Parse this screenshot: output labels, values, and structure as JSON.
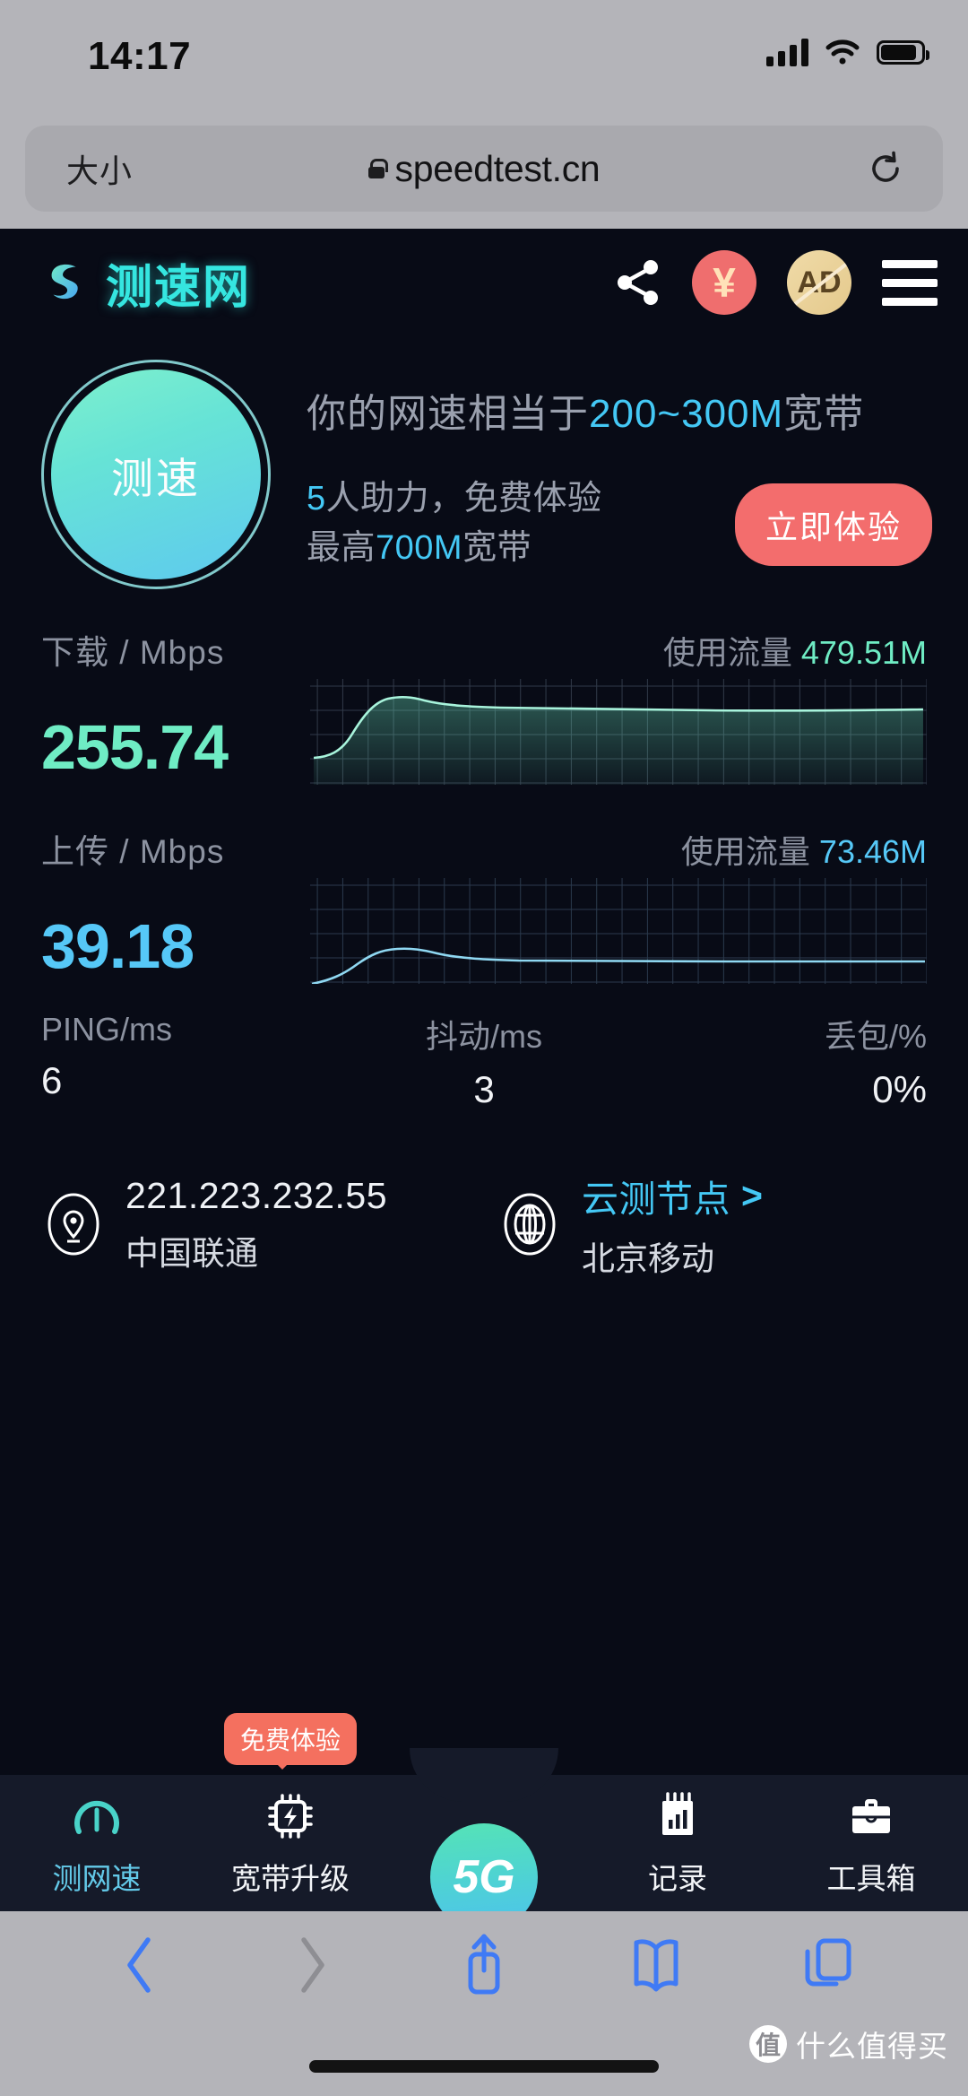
{
  "status_bar": {
    "time": "14:17",
    "signal_icon": "cellular-signal-icon",
    "wifi_icon": "wifi-icon",
    "battery_icon": "battery-icon"
  },
  "browser": {
    "text_size_label": "大小",
    "lock_icon": "lock-icon",
    "url": "speedtest.cn",
    "reload_icon": "reload-icon",
    "toolbar": {
      "back_icon": "back-chevron-icon",
      "forward_icon": "forward-chevron-icon",
      "share_icon": "share-icon",
      "bookmarks_icon": "book-icon",
      "tabs_icon": "tabs-icon"
    }
  },
  "app": {
    "header": {
      "logo_icon": "speedtest-logo-icon",
      "brand": "测速网",
      "share_icon": "share-nodes-icon",
      "yen_label": "¥",
      "ad_label": "AD",
      "menu_icon": "hamburger-menu-icon"
    },
    "hero": {
      "dial_label": "测速",
      "headline_prefix": "你的网速相当于",
      "headline_highlight": "200~300M",
      "headline_suffix": "宽带",
      "promo_line1_prefix": "",
      "promo_line1_highlight": "5",
      "promo_line1_suffix": "人助力，免费体验",
      "promo_line2_prefix": "最高",
      "promo_line2_highlight": "700M",
      "promo_line2_suffix": "宽带",
      "cta_label": "立即体验"
    },
    "download": {
      "label": "下载 / Mbps",
      "value": "255.74",
      "traffic_label": "使用流量",
      "traffic_value": "479.51M",
      "color": "#6fecc4"
    },
    "upload": {
      "label": "上传 / Mbps",
      "value": "39.18",
      "traffic_label": "使用流量",
      "traffic_value": "73.46M",
      "color": "#56c8f7"
    },
    "stats": [
      {
        "label": "PING/ms",
        "value": "6"
      },
      {
        "label": "抖动/ms",
        "value": "3"
      },
      {
        "label": "丢包/%",
        "value": "0%"
      }
    ],
    "info": {
      "location_icon": "location-pin-icon",
      "ip": "221.223.232.55",
      "isp": "中国联通",
      "globe_icon": "globe-icon",
      "node_label": "云测节点",
      "node_chevron": ">",
      "node_value": "北京移动"
    },
    "tabs": [
      {
        "label": "测网速",
        "icon": "speed-gauge-icon",
        "active": true,
        "badge": ""
      },
      {
        "label": "宽带升级",
        "icon": "chip-bolt-icon",
        "active": false,
        "badge": "免费体验"
      },
      {
        "label": "5G",
        "icon": "5g-button-icon",
        "active": false,
        "badge": ""
      },
      {
        "label": "记录",
        "icon": "records-chart-icon",
        "active": false,
        "badge": ""
      },
      {
        "label": "工具箱",
        "icon": "toolbox-icon",
        "active": false,
        "badge": ""
      }
    ]
  },
  "watermark": {
    "mark": "值",
    "text": "什么值得买"
  },
  "chart_data": [
    {
      "type": "area",
      "name": "download-speed-chart",
      "title": "下载 / Mbps",
      "ylabel": "Mbps",
      "grid": true,
      "ylim": [
        0,
        300
      ],
      "x": [
        0,
        4,
        8,
        12,
        16,
        20,
        24,
        28,
        32,
        36,
        40,
        44,
        48,
        52,
        56,
        60,
        64,
        68,
        72,
        76,
        80,
        84,
        88,
        92,
        96,
        100
      ],
      "values": [
        8,
        10,
        16,
        40,
        95,
        160,
        215,
        248,
        262,
        266,
        263,
        260,
        258,
        257,
        256,
        256,
        256,
        256,
        256,
        256,
        256,
        256,
        256,
        256,
        256,
        256
      ]
    },
    {
      "type": "line",
      "name": "upload-speed-chart",
      "title": "上传 / Mbps",
      "ylabel": "Mbps",
      "grid": true,
      "ylim": [
        0,
        300
      ],
      "x": [
        0,
        4,
        8,
        12,
        16,
        20,
        24,
        28,
        32,
        36,
        40,
        44,
        48,
        52,
        56,
        60,
        64,
        68,
        72,
        76,
        80,
        84,
        88,
        92,
        96,
        100
      ],
      "values": [
        2,
        3,
        6,
        14,
        28,
        42,
        50,
        52,
        50,
        47,
        44,
        42,
        41,
        40,
        39,
        39,
        39,
        39,
        39,
        39,
        39,
        39,
        39,
        39,
        39,
        39
      ]
    }
  ]
}
